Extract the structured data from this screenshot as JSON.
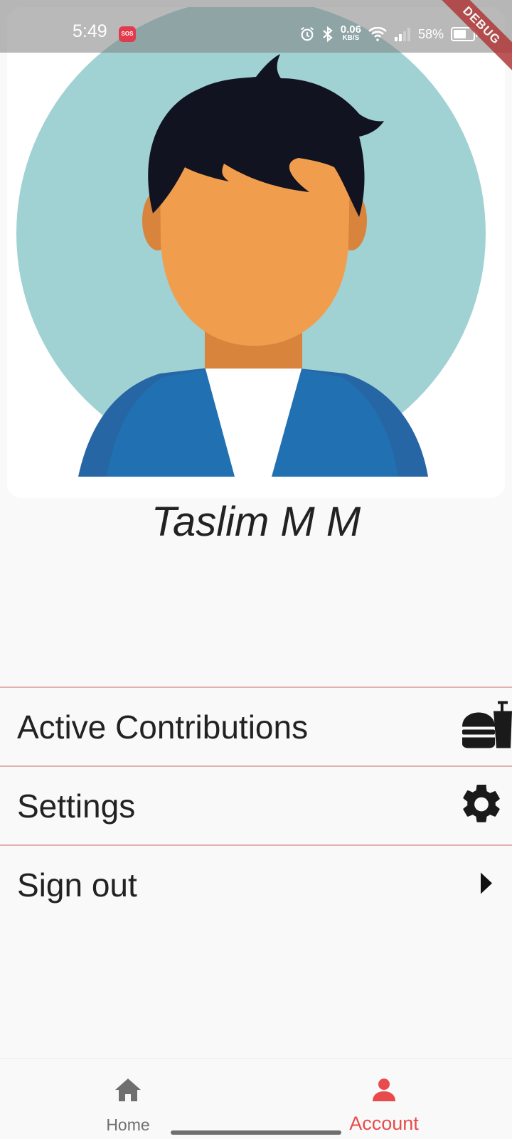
{
  "status_bar": {
    "time": "5:49",
    "sos": "SOS",
    "net_speed_value": "0.06",
    "net_speed_unit": "KB/S",
    "battery": "58%",
    "icons": [
      "alarm-icon",
      "bluetooth-icon",
      "wifi-icon",
      "signal-icon",
      "battery-icon"
    ]
  },
  "debug_banner": "DEBUG",
  "profile": {
    "name": "Taslim M M",
    "avatar": "avatar-illustration"
  },
  "menu": {
    "items": [
      {
        "label": "Active Contributions",
        "icon": "fast-food-icon"
      },
      {
        "label": "Settings",
        "icon": "gear-icon"
      },
      {
        "label": "Sign out",
        "icon": "arrow-right-icon"
      }
    ]
  },
  "bottom_nav": {
    "items": [
      {
        "label": "Home",
        "icon": "home-icon",
        "active": false
      },
      {
        "label": "Account",
        "icon": "person-icon",
        "active": true
      }
    ]
  },
  "colors": {
    "accent": "#e84b4b",
    "divider": "#e2b0ad",
    "avatar_bg": "#a0d1d3",
    "jacket": "#2170b2",
    "skin": "#f09e4e",
    "hair": "#111320"
  }
}
